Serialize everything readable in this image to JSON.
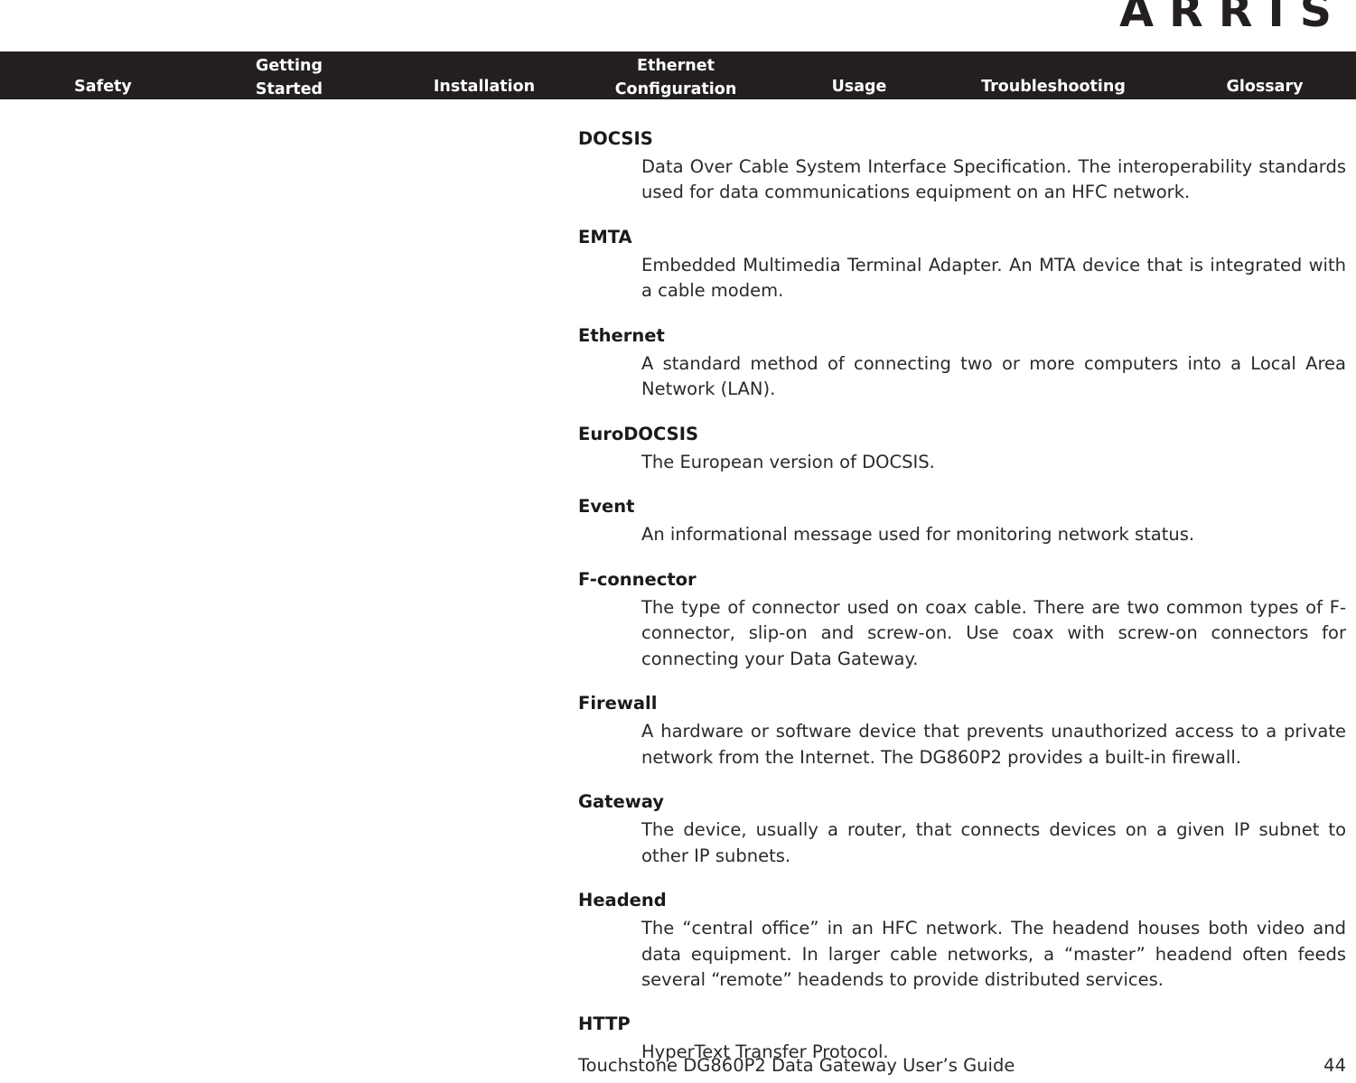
{
  "brand": {
    "logo_text": "ARRIS"
  },
  "nav": {
    "items": [
      {
        "id": "safety",
        "label": "Safety",
        "line1": "Safety",
        "line2": ""
      },
      {
        "id": "getting",
        "label": "Getting Started",
        "line1": "Getting",
        "line2": "Started"
      },
      {
        "id": "installation",
        "label": "Installation",
        "line1": "Installation",
        "line2": ""
      },
      {
        "id": "ethernet",
        "label": "Ethernet Configuration",
        "line1": "Ethernet",
        "line2": "Configuration"
      },
      {
        "id": "usage",
        "label": "Usage",
        "line1": "Usage",
        "line2": ""
      },
      {
        "id": "trouble",
        "label": "Troubleshooting",
        "line1": "Troubleshooting",
        "line2": ""
      },
      {
        "id": "glossary",
        "label": "Glossary",
        "line1": "Glossary",
        "line2": ""
      }
    ]
  },
  "glossary": {
    "entries": [
      {
        "term": "DOCSIS",
        "definition": "Data Over Cable System Interface Specification. The interoperability standards used for data communications equipment on an HFC network."
      },
      {
        "term": "EMTA",
        "definition": "Embedded Multimedia Terminal Adapter. An MTA device that is integrated with a cable modem."
      },
      {
        "term": "Ethernet",
        "definition": "A standard method of connecting two or more computers into a Local Area Network (LAN)."
      },
      {
        "term": "EuroDOCSIS",
        "definition": "The European version of DOCSIS."
      },
      {
        "term": "Event",
        "definition": "An informational message used for monitoring network status."
      },
      {
        "term": "F-connector",
        "definition": "The type of connector used on coax cable. There are two common types of F-connector, slip-on and screw-on. Use coax with screw-on connectors for connecting your Data Gateway."
      },
      {
        "term": "Firewall",
        "definition": "A hardware or software device that prevents unauthorized access to a private network from the Internet. The DG860P2 provides a built-in firewall."
      },
      {
        "term": "Gateway",
        "definition": "The device, usually a router, that connects devices on a given IP subnet to other IP subnets."
      },
      {
        "term": "Headend",
        "definition": "The “central office” in an HFC network. The headend houses both video and data equipment. In larger cable networks, a “master” headend often feeds several “remote” headends to provide distributed services."
      },
      {
        "term": "HTTP",
        "definition": "HyperText Transfer Protocol."
      }
    ]
  },
  "footer": {
    "title": "Touchstone DG860P2 Data Gateway User’s Guide",
    "page_number": "44"
  },
  "colors": {
    "nav_background": "#231f20",
    "nav_text": "#ffffff",
    "body_text": "#2a2a2a",
    "heading_text": "#1a1a1a",
    "page_background": "#ffffff"
  }
}
